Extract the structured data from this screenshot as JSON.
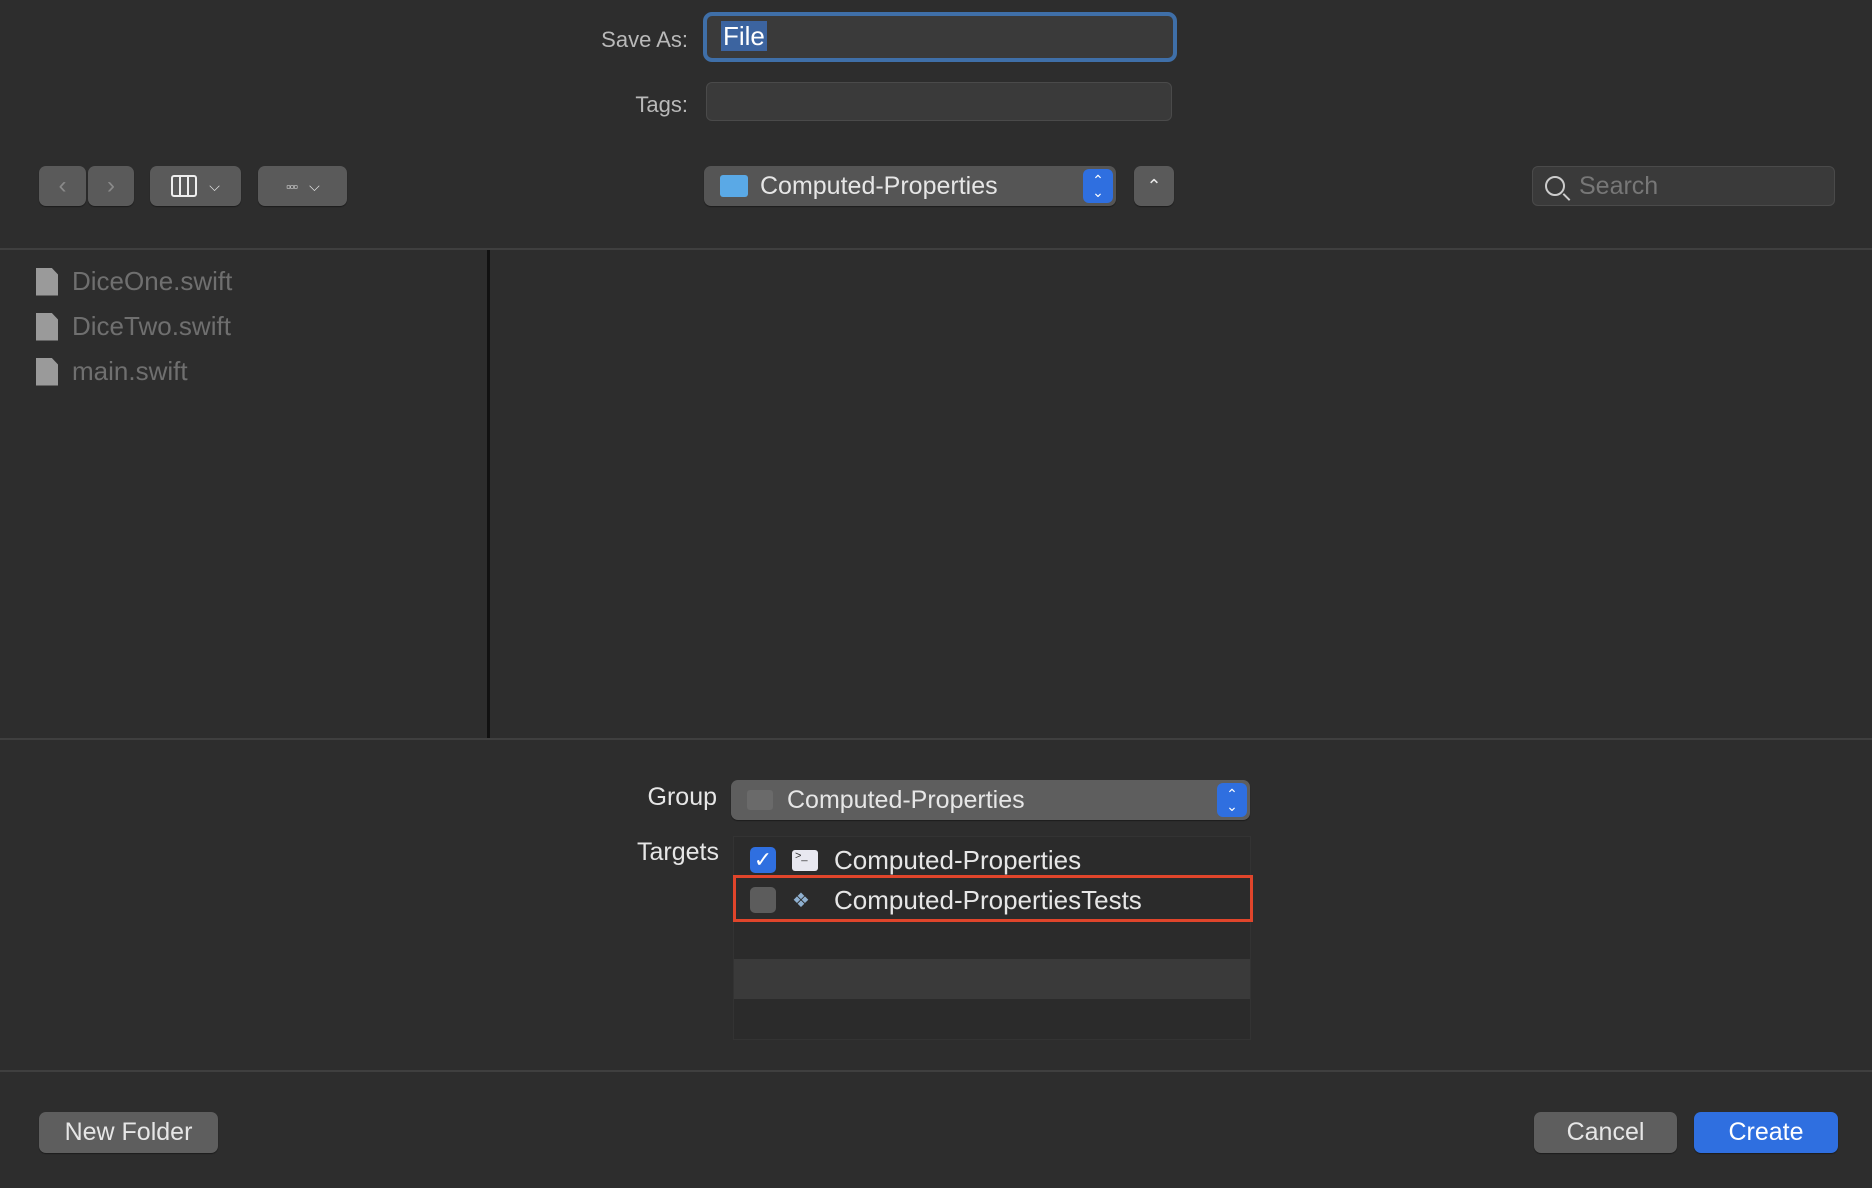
{
  "save_as": {
    "label": "Save As:",
    "value": "File"
  },
  "tags": {
    "label": "Tags:",
    "value": ""
  },
  "toolbar": {
    "path": "Computed-Properties",
    "search_placeholder": "Search"
  },
  "files": [
    {
      "name": "DiceOne.swift"
    },
    {
      "name": "DiceTwo.swift"
    },
    {
      "name": "main.swift"
    }
  ],
  "group": {
    "label": "Group",
    "value": "Computed-Properties"
  },
  "targets": {
    "label": "Targets",
    "items": [
      {
        "name": "Computed-Properties",
        "checked": true
      },
      {
        "name": "Computed-PropertiesTests",
        "checked": false
      }
    ]
  },
  "buttons": {
    "new_folder": "New Folder",
    "cancel": "Cancel",
    "create": "Create"
  },
  "colors": {
    "accent": "#2f6fe0",
    "highlight": "#e0452b"
  }
}
